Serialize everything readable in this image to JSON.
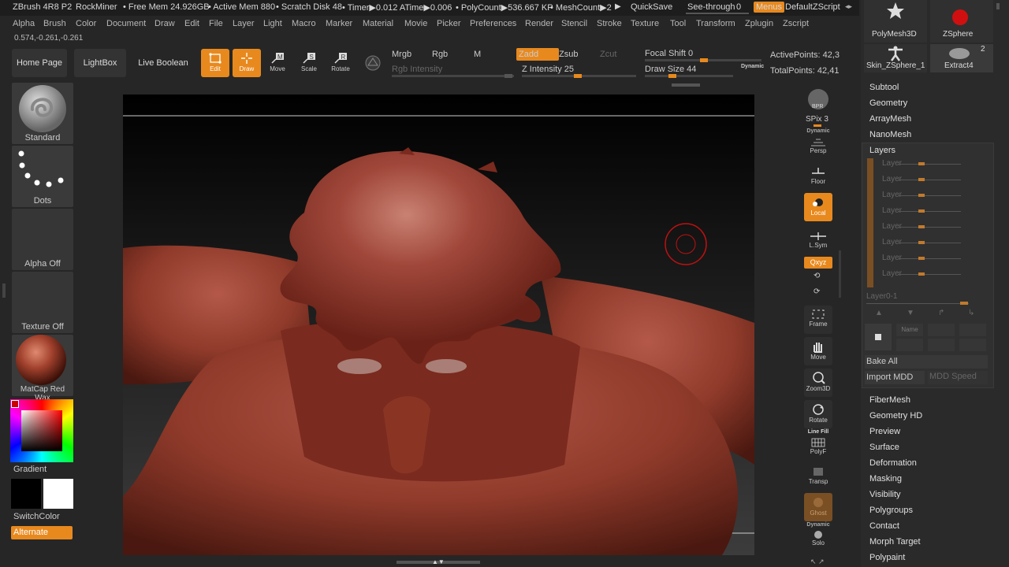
{
  "titlebar": {
    "app": "ZBrush 4R8 P2",
    "project": "RockMiner",
    "free_mem": "• Free Mem 24.926GB",
    "active_mem": "• Active Mem 880",
    "scratch": "• Scratch Disk 48",
    "timer": "• Timer▶0.012 ATime▶0.006",
    "polycount": "• PolyCount▶536.667 KP",
    "meshcount": "• MeshCount▶2",
    "quicksave": "QuickSave",
    "see_through": "See-through",
    "see_through_value": "0",
    "menus": "Menus",
    "script": "DefaultZScript"
  },
  "menu": [
    "Alpha",
    "Brush",
    "Color",
    "Document",
    "Draw",
    "Edit",
    "File",
    "Layer",
    "Light",
    "Macro",
    "Marker",
    "Material",
    "Movie",
    "Picker",
    "Preferences",
    "Render",
    "Stencil",
    "Stroke",
    "Texture",
    "Tool",
    "Transform",
    "Zplugin",
    "Zscript"
  ],
  "coords": "0.574,-0.261,-0.261",
  "toolbar": {
    "home": "Home Page",
    "lightbox": "LightBox",
    "live_boolean": "Live Boolean",
    "edit": "Edit",
    "draw": "Draw",
    "move": "Move",
    "scale": "Scale",
    "rotate": "Rotate",
    "mrgb": "Mrgb",
    "rgb": "Rgb",
    "m": "M",
    "zadd": "Zadd",
    "zsub": "Zsub",
    "zcut": "Zcut",
    "rgb_intensity": "Rgb Intensity",
    "z_intensity": "Z Intensity 25",
    "z_intensity_value": 25,
    "focal_shift": "Focal Shift 0",
    "draw_size": "Draw Size 44",
    "dynamic": "Dynamic",
    "active_points": "ActivePoints: 42,3",
    "total_points": "TotalPoints: 42,41"
  },
  "left": {
    "brush": "Standard",
    "stroke": "Dots",
    "alpha": "Alpha Off",
    "texture": "Texture Off",
    "material": "MatCap Red Wax",
    "gradient": "Gradient",
    "switchcolor": "SwitchColor",
    "alternate": "Alternate"
  },
  "shelf": {
    "bpr": "BPR",
    "spix": "SPix 3",
    "dynamic": "Dynamic",
    "persp": "Persp",
    "floor": "Floor",
    "local": "Local",
    "lsym": "L.Sym",
    "xyz": "Qxyz",
    "frame": "Frame",
    "move": "Move",
    "zoom3d": "Zoom3D",
    "rotate": "Rotate",
    "linefill": "Line Fill",
    "polyf": "PolyF",
    "transp": "Transp",
    "ghost": "Ghost",
    "dynamic2": "Dynamic",
    "solo": "Solo"
  },
  "subtools": {
    "polymesh": "PolyMesh3D",
    "zsphere": "ZSphere",
    "skin": "Skin_ZSphere_1",
    "extract": "Extract4",
    "extract_count": "2"
  },
  "panel_top": [
    "Subtool",
    "Geometry",
    "ArrayMesh",
    "NanoMesh"
  ],
  "layers": {
    "title": "Layers",
    "rows": [
      "Layer",
      "Layer",
      "Layer",
      "Layer",
      "Layer",
      "Layer",
      "Layer",
      "Layer"
    ],
    "current": "Layer0-1",
    "name": "Name",
    "bake_all": "Bake All",
    "import_mdd": "Import MDD",
    "mdd_speed": "MDD Speed"
  },
  "panel_bottom": [
    "FiberMesh",
    "Geometry HD",
    "Preview",
    "Surface",
    "Deformation",
    "Masking",
    "Visibility",
    "Polygroups",
    "Contact",
    "Morph Target",
    "Polypaint"
  ],
  "colors": {
    "accent": "#e8891e",
    "clay": "#8f3a2a"
  }
}
